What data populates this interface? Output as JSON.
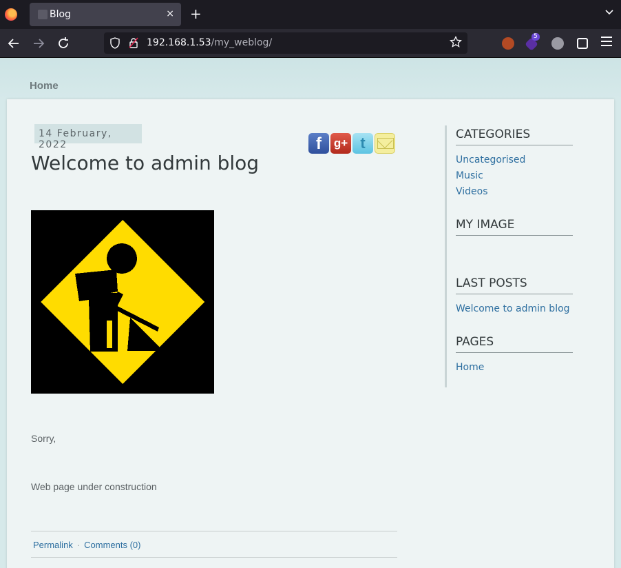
{
  "browser": {
    "tab_title": "Blog",
    "tab_close": "×",
    "new_tab": "+",
    "url_host": "192.168.1.53",
    "url_path": "/my_weblog/",
    "ext_badge": "5"
  },
  "page": {
    "nav_home": "Home",
    "post": {
      "date": "14 February, 2022",
      "title": "Welcome to admin blog",
      "paragraph1": "Sorry,",
      "paragraph2": "Web page under construction",
      "permalink": "Permalink",
      "separator": "·",
      "comments": "Comments (0)",
      "share": {
        "facebook": "f",
        "google": "g+",
        "twitter": "t"
      }
    },
    "sidebar": {
      "categories_heading": "CATEGORIES",
      "categories": [
        "Uncategorised",
        "Music",
        "Videos"
      ],
      "image_heading": "MY IMAGE",
      "last_posts_heading": "LAST POSTS",
      "last_posts": [
        "Welcome to admin blog"
      ],
      "pages_heading": "PAGES",
      "pages": [
        "Home"
      ]
    }
  },
  "colors": {
    "accent_link": "#2e6fa0",
    "sign_yellow": "#ffdc00"
  }
}
